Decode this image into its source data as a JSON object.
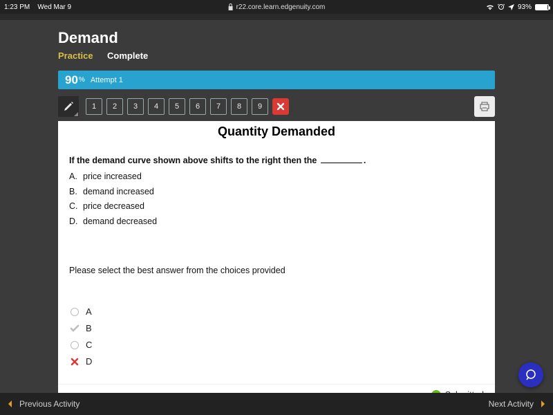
{
  "statusbar": {
    "time": "1:23 PM",
    "date": "Wed Mar 9",
    "domain": "r22.core.learn.edgenuity.com",
    "battery_pct": "93%"
  },
  "header": {
    "title": "Demand",
    "tab_practice": "Practice",
    "tab_complete": "Complete"
  },
  "score": {
    "percent": "90",
    "suffix": "%",
    "attempt": "Attempt 1"
  },
  "toolbar": {
    "questions": [
      "1",
      "2",
      "3",
      "4",
      "5",
      "6",
      "7",
      "8",
      "9"
    ]
  },
  "content": {
    "qd_title": "Quantity Demanded",
    "stem_pre": "If the demand curve shown above shifts to the right then the ",
    "stem_post": ".",
    "options": [
      {
        "letter": "A.",
        "text": "price increased"
      },
      {
        "letter": "B.",
        "text": "demand increased"
      },
      {
        "letter": "C.",
        "text": "price decreased"
      },
      {
        "letter": "D.",
        "text": "demand decreased"
      }
    ],
    "instruction": "Please select the best answer from the choices provided"
  },
  "answers": {
    "a": "A",
    "b": "B",
    "c": "C",
    "d": "D"
  },
  "footer": {
    "status": "Submitted"
  },
  "bottomnav": {
    "prev": "Previous Activity",
    "next": "Next Activity"
  }
}
